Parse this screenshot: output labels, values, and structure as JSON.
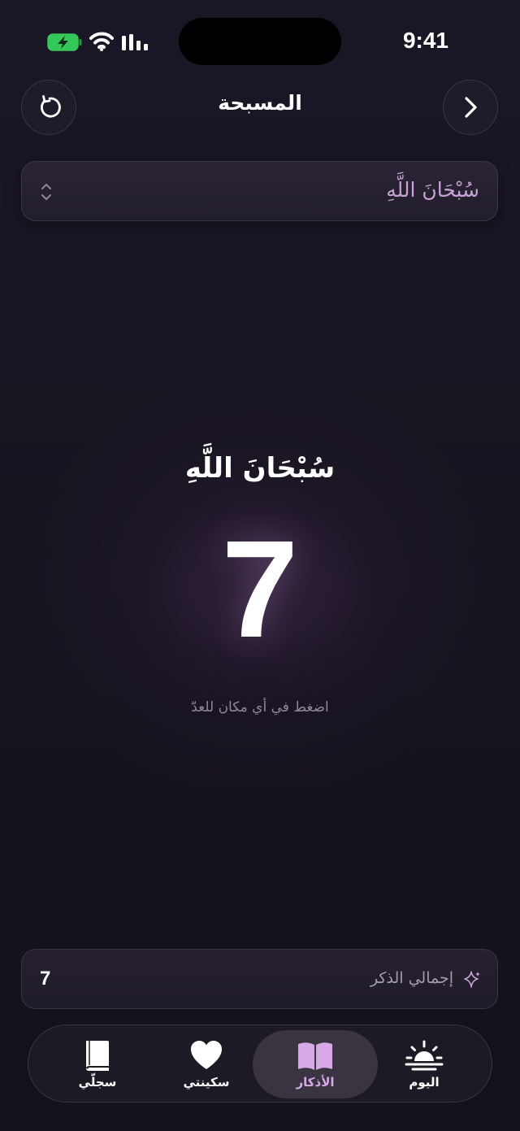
{
  "status_bar": {
    "time": "9:41"
  },
  "header": {
    "title": "المسبحة"
  },
  "selector": {
    "value": "سُبْحَانَ اللَّهِ"
  },
  "counter": {
    "dhikr": "سُبْحَانَ اللَّهِ",
    "count": "7",
    "hint": "اضغط في أي مكان للعدّ"
  },
  "total": {
    "label": "إجمالي الذكر",
    "value": "7"
  },
  "tabs": [
    {
      "label": "سجلّي",
      "icon": "book-icon",
      "active": false
    },
    {
      "label": "سكينتي",
      "icon": "heart-icon",
      "active": false
    },
    {
      "label": "الأذكار",
      "icon": "open-book-icon",
      "active": true
    },
    {
      "label": "اليوم",
      "icon": "sunrise-icon",
      "active": false
    }
  ],
  "colors": {
    "accent": "#d7a9e6",
    "background": "#16121e",
    "battery": "#34c759"
  }
}
